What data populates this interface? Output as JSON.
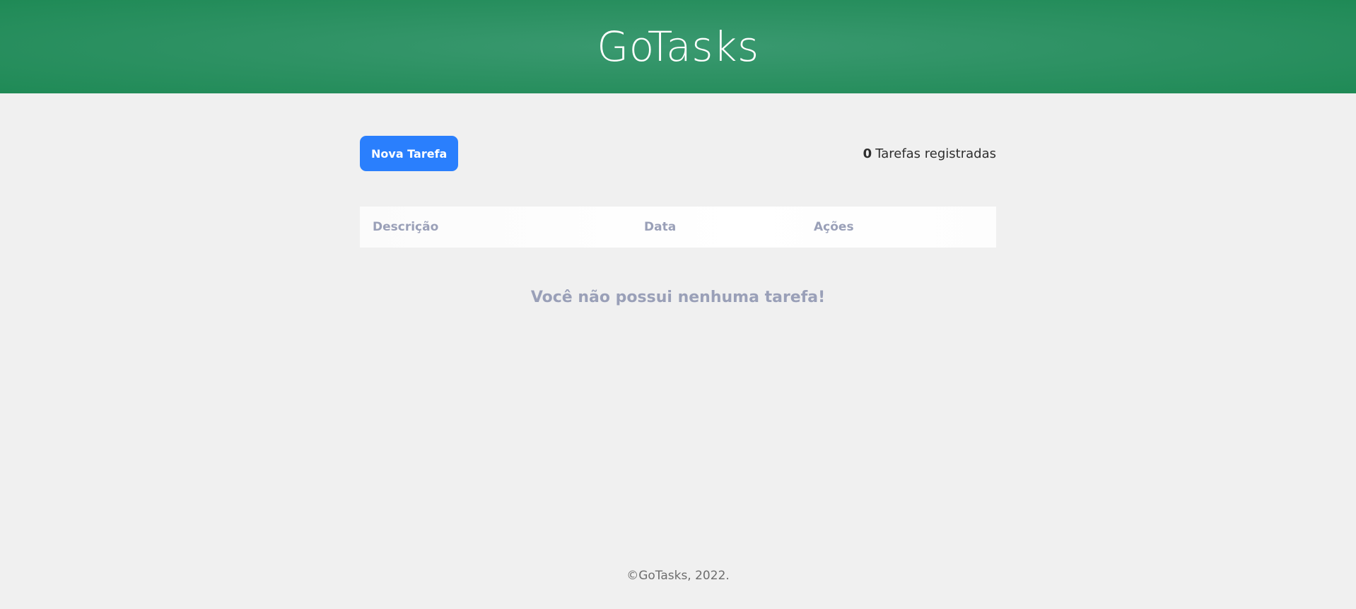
{
  "header": {
    "title": "GoTasks",
    "background_color": "#2e9264"
  },
  "toolbar": {
    "new_task_label": "Nova Tarefa",
    "task_count": "0",
    "task_count_label": "Tarefas registradas",
    "button_color": "#2a7ffd"
  },
  "table": {
    "columns": [
      "Descrição",
      "Data",
      "Ações"
    ]
  },
  "empty_state": {
    "message": "Você não possui nenhuma tarefa!"
  },
  "footer": {
    "text": "©GoTasks, 2022."
  }
}
